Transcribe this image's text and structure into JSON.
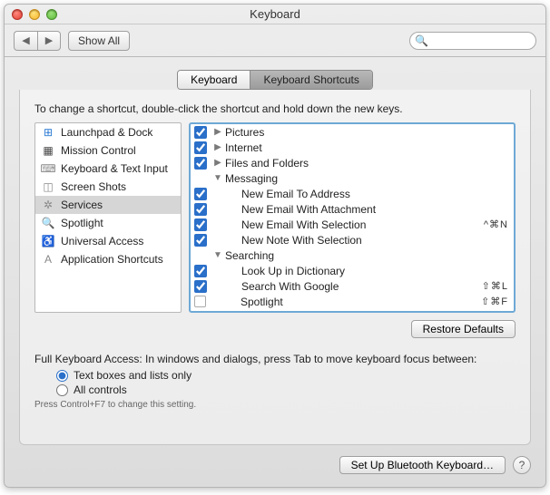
{
  "window": {
    "title": "Keyboard",
    "toolbar": {
      "back": "◀",
      "fwd": "▶",
      "show_all": "Show All",
      "search_placeholder": ""
    }
  },
  "tabs": {
    "keyboard": "Keyboard",
    "shortcuts": "Keyboard Shortcuts"
  },
  "instruction": "To change a shortcut, double-click the shortcut and hold down the new keys.",
  "categories": [
    {
      "label": "Launchpad & Dock",
      "icon": "launchpad-icon",
      "glyph": "⊞",
      "color": "#2a7ad4"
    },
    {
      "label": "Mission Control",
      "icon": "mission-control-icon",
      "glyph": "▦",
      "color": "#444"
    },
    {
      "label": "Keyboard & Text Input",
      "icon": "keyboard-icon",
      "glyph": "⌨",
      "color": "#888"
    },
    {
      "label": "Screen Shots",
      "icon": "screenshot-icon",
      "glyph": "◫",
      "color": "#888"
    },
    {
      "label": "Services",
      "icon": "services-icon",
      "glyph": "✲",
      "color": "#888",
      "selected": true
    },
    {
      "label": "Spotlight",
      "icon": "spotlight-icon",
      "glyph": "🔍",
      "color": "#2a7ad4"
    },
    {
      "label": "Universal Access",
      "icon": "universal-access-icon",
      "glyph": "♿",
      "color": "#2a7ad4"
    },
    {
      "label": "Application Shortcuts",
      "icon": "app-shortcuts-icon",
      "glyph": "A",
      "color": "#888"
    }
  ],
  "services": [
    {
      "type": "group",
      "checked": true,
      "disclosure": "right",
      "label": "Pictures"
    },
    {
      "type": "group",
      "checked": true,
      "disclosure": "right",
      "label": "Internet"
    },
    {
      "type": "group",
      "checked": true,
      "disclosure": "right",
      "label": "Files and Folders"
    },
    {
      "type": "group",
      "checked": false,
      "nocb": true,
      "disclosure": "down",
      "label": "Messaging"
    },
    {
      "type": "item",
      "checked": true,
      "label": "New Email To Address"
    },
    {
      "type": "item",
      "checked": true,
      "label": "New Email With Attachment"
    },
    {
      "type": "item",
      "checked": true,
      "label": "New Email With Selection",
      "shortcut": "^⌘N"
    },
    {
      "type": "item",
      "checked": true,
      "label": "New Note With Selection"
    },
    {
      "type": "group",
      "checked": false,
      "nocb": true,
      "disclosure": "down",
      "label": "Searching"
    },
    {
      "type": "item",
      "checked": true,
      "label": "Look Up in Dictionary"
    },
    {
      "type": "item",
      "checked": true,
      "label": "Search With Google",
      "shortcut": "⇧⌘L"
    },
    {
      "type": "item",
      "checked": false,
      "empty": true,
      "label": "Spotlight",
      "shortcut": "⇧⌘F"
    }
  ],
  "restore_defaults": "Restore Defaults",
  "fka": {
    "label": "Full Keyboard Access: In windows and dialogs, press Tab to move keyboard focus between:",
    "opt1": "Text boxes and lists only",
    "opt2": "All controls",
    "hint": "Press Control+F7 to change this setting."
  },
  "bluetooth_btn": "Set Up Bluetooth Keyboard…",
  "help": "?"
}
